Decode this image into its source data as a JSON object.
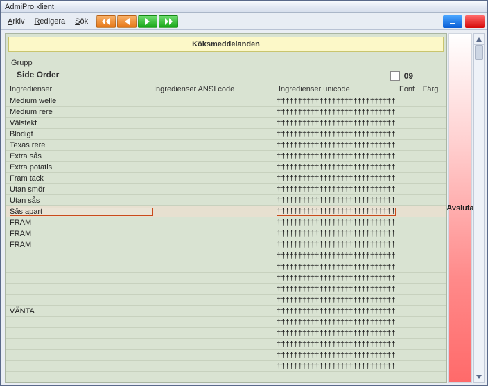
{
  "window": {
    "title": "AdmiPro klient"
  },
  "menu": {
    "arkiv": "Arkiv",
    "redigera": "Redigera",
    "sok": "Sök"
  },
  "panel": {
    "title": "Köksmeddelanden",
    "group_label": "Grupp",
    "group_value": "Side Order",
    "number": "09",
    "columns": {
      "ingredienser": "Ingredienser",
      "ansi": "Ingredienser ANSI code",
      "unicode": "Ingredienser unicode",
      "font": "Font",
      "farg": "Färg"
    }
  },
  "sidebar": {
    "label": "Avsluta"
  },
  "rows": [
    {
      "name": "Medium welle",
      "unicode": "††††††††††††††††††††††††††††"
    },
    {
      "name": "Medium rere",
      "unicode": "††††††††††††††††††††††††††††"
    },
    {
      "name": "Välstekt",
      "unicode": "††††††††††††††††††††††††††††"
    },
    {
      "name": "Blodigt",
      "unicode": "††††††††††††††††††††††††††††"
    },
    {
      "name": "Texas rere",
      "unicode": "††††††††††††††††††††††††††††"
    },
    {
      "name": "Extra sås",
      "unicode": "††††††††††††††††††††††††††††"
    },
    {
      "name": "Extra potatis",
      "unicode": "††††††††††††††††††††††††††††"
    },
    {
      "name": "Fram tack",
      "unicode": "††††††††††††††††††††††††††††"
    },
    {
      "name": "Utan smör",
      "unicode": "††††††††††††††††††††††††††††"
    },
    {
      "name": "Utan sås",
      "unicode": "††††††††††††††††††††††††††††"
    },
    {
      "name": "Sås apart",
      "unicode": "††††††††††††††††††††††††††††",
      "selected": true
    },
    {
      "name": "FRAM",
      "unicode": "††††††††††††††††††††††††††††"
    },
    {
      "name": "FRAM",
      "unicode": "††††††††††††††††††††††††††††"
    },
    {
      "name": "FRAM",
      "unicode": "††††††††††††††††††††††††††††"
    },
    {
      "name": "",
      "unicode": "††††††††††††††††††††††††††††"
    },
    {
      "name": "",
      "unicode": "††††††††††††††††††††††††††††"
    },
    {
      "name": "",
      "unicode": "††††††††††††††††††††††††††††"
    },
    {
      "name": "",
      "unicode": "††††††††††††††††††††††††††††"
    },
    {
      "name": "",
      "unicode": "††††††††††††††††††††††††††††"
    },
    {
      "name": "VÄNTA",
      "unicode": "††††††††††††††††††††††††††††"
    },
    {
      "name": "",
      "unicode": "††††††††††††††††††††††††††††"
    },
    {
      "name": "",
      "unicode": "††††††††††††††††††††††††††††"
    },
    {
      "name": "",
      "unicode": "††††††††††††††††††††††††††††"
    },
    {
      "name": "",
      "unicode": "††††††††††††††††††††††††††††"
    },
    {
      "name": "",
      "unicode": "††††††††††††††††††††††††††††"
    }
  ]
}
